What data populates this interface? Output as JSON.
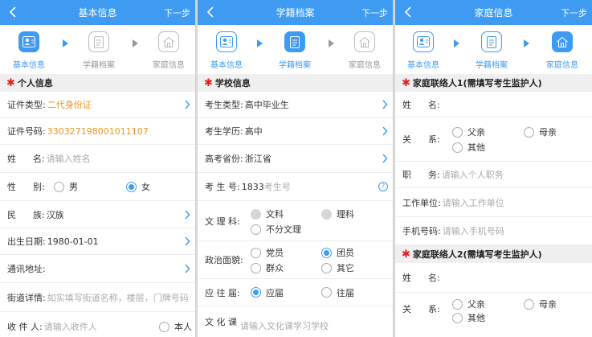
{
  "panel1": {
    "nav": {
      "title": "基本信息",
      "next": "下一步"
    },
    "steps": [
      "基本信息",
      "学籍档案",
      "家庭信息"
    ],
    "section": "个人信息",
    "id_type": {
      "label": "证件类型:",
      "value": "二代身份证"
    },
    "id_number": {
      "label": "证件号码:",
      "value": "330327198001011107"
    },
    "name": {
      "label": "姓      名:",
      "placeholder": "请输入姓名"
    },
    "gender": {
      "label": "性      别:",
      "options": [
        "男",
        "女"
      ],
      "selected": "女"
    },
    "ethnicity": {
      "label": "民      族:",
      "value": "汉族"
    },
    "birthday": {
      "label": "出生日期:",
      "value": "1980-01-01"
    },
    "address": {
      "label": "通讯地址:"
    },
    "street": {
      "label": "街道详情:",
      "placeholder": "如实填写街道名称，楼层，门牌号码"
    },
    "recipient": {
      "label": "收 件 人:",
      "placeholder": "请输入收件人",
      "self_option": "本人"
    }
  },
  "panel2": {
    "nav": {
      "title": "学籍档案",
      "next": "下一步"
    },
    "steps": [
      "基本信息",
      "学籍档案",
      "家庭信息"
    ],
    "section": "学校信息",
    "exam_type": {
      "label": "考生类型:",
      "value": "高中毕业生"
    },
    "education": {
      "label": "考生学历:",
      "value": "高中"
    },
    "province": {
      "label": "高考省份:",
      "value": "浙江省"
    },
    "exam_no": {
      "label": "考 生 号:",
      "prefix": "1833",
      "placeholder": "考生号"
    },
    "subject": {
      "label": "文 理 科:",
      "options": [
        "文科",
        "理科",
        "不分文理"
      ]
    },
    "political": {
      "label": "政治面貌:",
      "options": [
        "党员",
        "团员",
        "群众",
        "其它"
      ],
      "selected": "团员"
    },
    "graduate": {
      "label": "应 往 届:",
      "options": [
        "应届",
        "往届"
      ],
      "selected": "应届"
    },
    "culture": {
      "label": "文 化 课",
      "placeholder": "请输入文化课学习学校"
    }
  },
  "panel3": {
    "nav": {
      "title": "家庭信息",
      "next": "下一步"
    },
    "steps": [
      "基本信息",
      "学籍档案",
      "家庭信息"
    ],
    "section1": "家庭联络人1(需填写考生监护人)",
    "section2": "家庭联络人2(需填写考生监护人)",
    "name_label": "姓      名:",
    "relation_label": "关      系:",
    "relation_options": [
      "父亲",
      "母亲",
      "其他"
    ],
    "position": {
      "label": "职      务:",
      "placeholder": "请输入个人职务"
    },
    "workplace": {
      "label": "工作单位:",
      "placeholder": "请输入工作单位"
    },
    "phone": {
      "label": "手机号码:",
      "placeholder": "请输入手机号码"
    }
  },
  "colors": {
    "accent": "#3e9bf1",
    "orange": "#f0921d",
    "required": "#e02020"
  }
}
